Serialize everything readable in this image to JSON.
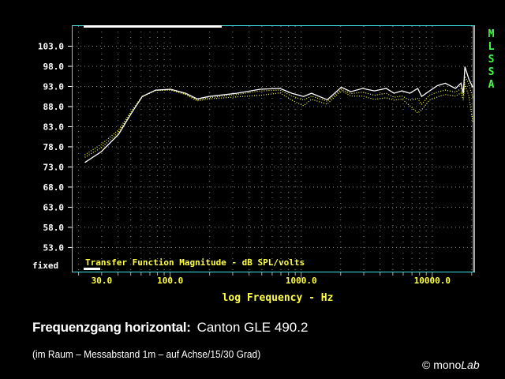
{
  "chart_data": {
    "type": "line",
    "title": "Transfer Function Magnitude - dB SPL/volts",
    "xlabel": "log Frequency - Hz",
    "ylabel": "",
    "xscale": "log",
    "xlim": [
      18,
      20900
    ],
    "ylim": [
      47,
      108
    ],
    "yticks": [
      "103.0",
      "98.0",
      "93.0",
      "88.0",
      "83.0",
      "78.0",
      "73.0",
      "68.0",
      "63.0",
      "58.0",
      "53.0"
    ],
    "ytick_values": [
      103,
      98,
      93,
      88,
      83,
      78,
      73,
      68,
      63,
      58,
      53
    ],
    "xticks": [
      "30.0",
      "100.0",
      "1000.0",
      "10000.0"
    ],
    "xtick_values": [
      30,
      100,
      1000,
      10000
    ],
    "y_mode_label": "fixed",
    "side_label": "MLSSA",
    "grid": true,
    "series": [
      {
        "name": "auf Achse",
        "style": "solid",
        "color": "#ffffff",
        "x": [
          22.3,
          29.8,
          40.4,
          49.8,
          61.2,
          77.4,
          100.7,
          131,
          161,
          198,
          322,
          487,
          689,
          847,
          1042,
          1197,
          1578,
          2025,
          2390,
          2940,
          3620,
          4450,
          5110,
          5870,
          6740,
          7740,
          8300,
          9530,
          10940,
          12560,
          15040,
          16560,
          17270,
          17750,
          19020,
          20380
        ],
        "y": [
          74.1,
          76.8,
          81.1,
          86.0,
          90.5,
          92.1,
          92.3,
          91.3,
          89.9,
          90.5,
          91.3,
          92.3,
          92.5,
          91.3,
          90.5,
          91.3,
          89.7,
          92.8,
          91.7,
          92.5,
          91.9,
          92.5,
          91.3,
          91.9,
          91.3,
          92.5,
          90.5,
          91.9,
          93.2,
          93.8,
          92.5,
          93.8,
          91.3,
          97.9,
          94.8,
          92.8
        ]
      },
      {
        "name": "15 Grad",
        "style": "dotted",
        "color": "#ffff40",
        "x": [
          22.3,
          29.8,
          40.4,
          49.8,
          61.2,
          77.4,
          100.7,
          131,
          161,
          198,
          322,
          487,
          689,
          847,
          1042,
          1197,
          1578,
          2025,
          2390,
          2940,
          3620,
          4450,
          5110,
          5870,
          6740,
          7740,
          8300,
          9530,
          10940,
          12560,
          15040,
          16560,
          17270,
          17750,
          19020,
          20380
        ],
        "y": [
          75.4,
          77.8,
          81.6,
          86.2,
          90.4,
          92.0,
          92.2,
          91.1,
          89.6,
          90.2,
          91.0,
          91.9,
          92.1,
          90.6,
          89.6,
          90.6,
          89.3,
          92.3,
          91.2,
          91.6,
          90.8,
          91.3,
          90.3,
          90.6,
          89.6,
          90.0,
          88.6,
          90.8,
          91.6,
          92.1,
          91.6,
          92.4,
          90.6,
          95.5,
          93.6,
          90.2
        ]
      },
      {
        "name": "30 Grad",
        "style": "dotted",
        "color": "#ffff40",
        "x": [
          22.3,
          29.8,
          40.4,
          49.8,
          61.2,
          77.4,
          100.7,
          131,
          161,
          198,
          322,
          487,
          689,
          847,
          1042,
          1197,
          1578,
          2025,
          2390,
          2940,
          3620,
          4450,
          5110,
          5870,
          6740,
          7740,
          8300,
          9530,
          10940,
          12560,
          15040,
          16560,
          17270,
          17750,
          19020,
          20380
        ],
        "y": [
          76.0,
          78.6,
          82.2,
          86.6,
          90.6,
          92.0,
          92.1,
          91.0,
          89.4,
          89.9,
          90.4,
          90.8,
          91.4,
          89.6,
          88.2,
          89.8,
          88.6,
          92.0,
          90.6,
          90.6,
          89.8,
          90.2,
          89.6,
          89.9,
          88.2,
          86.4,
          87.2,
          89.6,
          90.4,
          91.0,
          90.6,
          91.4,
          89.6,
          93.6,
          90.6,
          84.2
        ]
      }
    ]
  },
  "caption": {
    "title_bold": "Frequenzgang horizontal:",
    "title_model": "Canton GLE 490.2",
    "subtitle": "(im Raum – Messabstand 1m – auf Achse/15/30 Grad)",
    "copyright_symbol": "©",
    "brand_mono": "mono",
    "brand_lab": "Lab"
  },
  "colors": {
    "frame": "#40e0e0",
    "grid": "#808080",
    "label": "#ffff40",
    "tick_label": "#ffffff",
    "side": "#40ff40"
  }
}
